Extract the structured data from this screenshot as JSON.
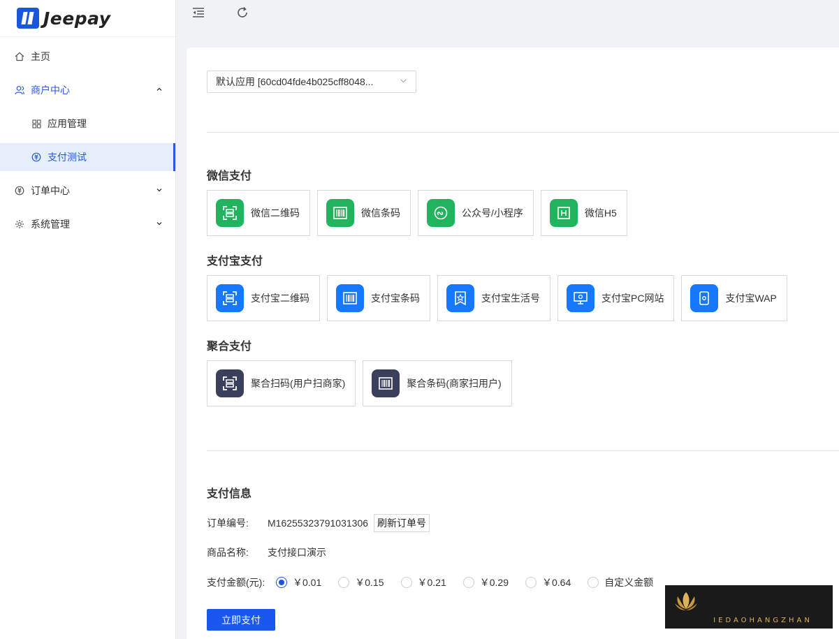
{
  "brand": {
    "name": "Jeepay"
  },
  "sidebar": {
    "items": [
      {
        "label": "主页",
        "icon": "home-icon"
      },
      {
        "label": "商户中心",
        "icon": "user-group-icon",
        "expanded": true
      },
      {
        "label": "应用管理",
        "icon": "grid-icon"
      },
      {
        "label": "支付测试",
        "icon": "pay-test-icon",
        "active": true
      },
      {
        "label": "订单中心",
        "icon": "order-icon"
      },
      {
        "label": "系统管理",
        "icon": "gear-icon"
      }
    ]
  },
  "header": {
    "collapse_icon": "menu-fold-icon",
    "refresh_icon": "reload-icon"
  },
  "app_select": {
    "value": "默认应用 [60cd04fde4b025cff8048..."
  },
  "sections": {
    "wechat": {
      "title": "微信支付",
      "methods": [
        "微信二维码",
        "微信条码",
        "公众号/小程序",
        "微信H5"
      ]
    },
    "alipay": {
      "title": "支付宝支付",
      "methods": [
        "支付宝二维码",
        "支付宝条码",
        "支付宝生活号",
        "支付宝PC网站",
        "支付宝WAP"
      ]
    },
    "aggregate": {
      "title": "聚合支付",
      "methods": [
        "聚合扫码(用户扫商家)",
        "聚合条码(商家扫用户)"
      ]
    }
  },
  "pay_info": {
    "title": "支付信息",
    "order_label": "订单编号:",
    "order_no": "M16255323791031306",
    "refresh_label": "刷新订单号",
    "product_label": "商品名称:",
    "product_name": "支付接口演示",
    "amount_label": "支付金额(元):",
    "amounts": [
      "￥0.01",
      "￥0.15",
      "￥0.21",
      "￥0.29",
      "￥0.64",
      "自定义金额"
    ],
    "selected_amount": "￥0.01",
    "submit_label": "立即支付"
  },
  "watermark": {
    "text": "IEDAOHANGZHAN"
  },
  "colors": {
    "primary": "#1a56f0",
    "wechat": "#22b35e",
    "alipay": "#1677ff",
    "aggregate": "#3a3f5c"
  }
}
